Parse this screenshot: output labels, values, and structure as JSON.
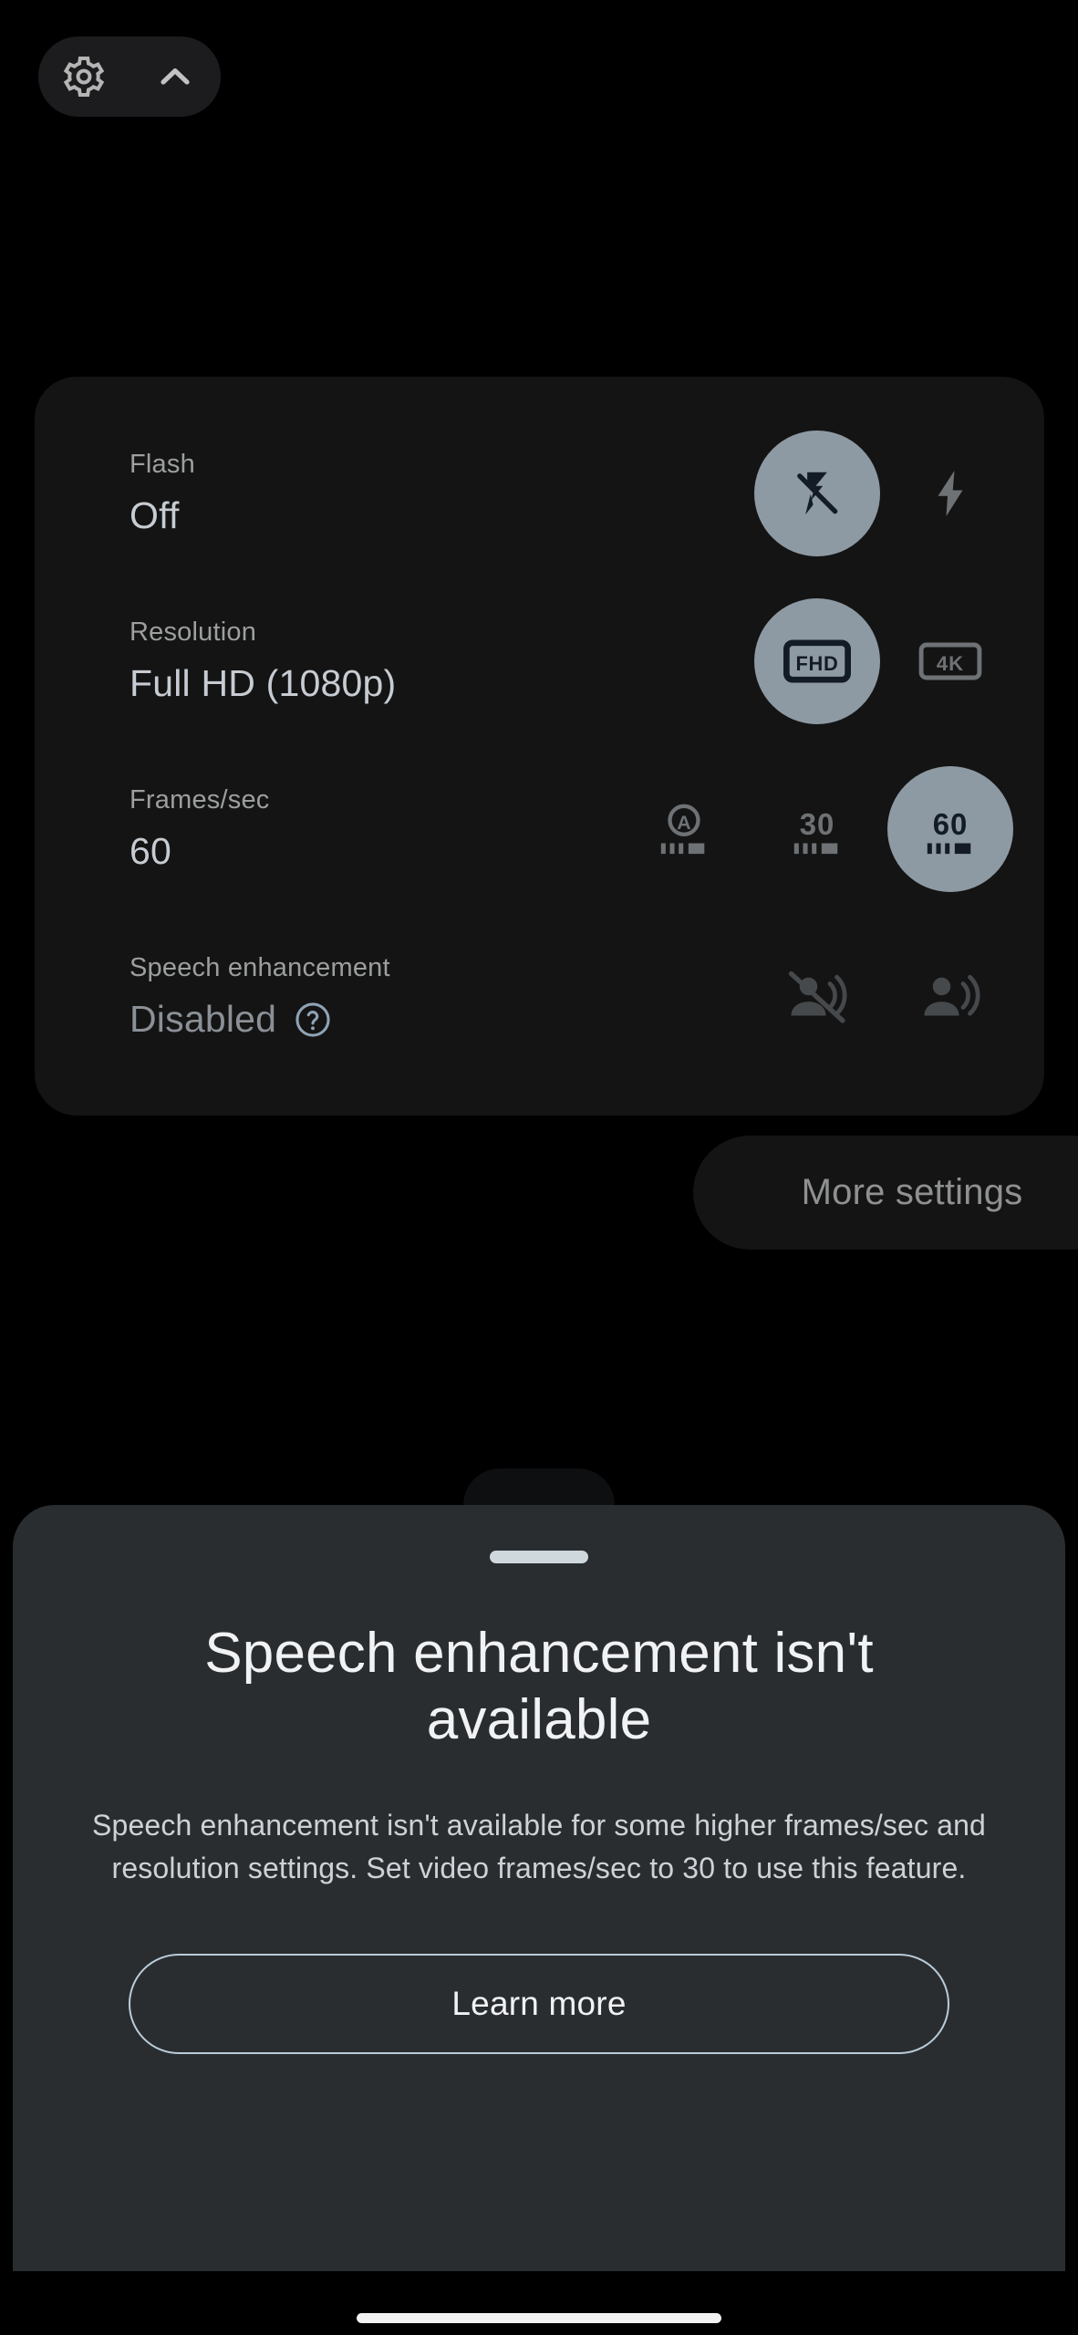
{
  "top_bar": {
    "settings_icon": "gear-icon",
    "collapse_icon": "chevron-up-icon"
  },
  "settings_panel": {
    "rows": [
      {
        "id": "flash",
        "label": "Flash",
        "value": "Off",
        "enabled": true,
        "options": [
          {
            "id": "flash-off",
            "icon": "flash-off-icon",
            "selected": true
          },
          {
            "id": "flash-on",
            "icon": "flash-on-icon",
            "selected": false
          }
        ]
      },
      {
        "id": "resolution",
        "label": "Resolution",
        "value": "Full HD (1080p)",
        "enabled": true,
        "options": [
          {
            "id": "resolution-fhd",
            "icon": "fhd-icon",
            "text": "FHD",
            "selected": true
          },
          {
            "id": "resolution-4k",
            "icon": "4k-icon",
            "text": "4K",
            "selected": false
          }
        ]
      },
      {
        "id": "frames-per-second",
        "label": "Frames/sec",
        "value": "60",
        "enabled": true,
        "options": [
          {
            "id": "fps-auto",
            "icon": "fps-auto-icon",
            "text": "A",
            "selected": false
          },
          {
            "id": "fps-30",
            "icon": "fps-30-icon",
            "text": "30",
            "selected": false
          },
          {
            "id": "fps-60",
            "icon": "fps-60-icon",
            "text": "60",
            "selected": true
          }
        ]
      },
      {
        "id": "speech-enhancement",
        "label": "Speech enhancement",
        "value": "Disabled",
        "enabled": false,
        "help_icon": "help-circle-icon",
        "options": [
          {
            "id": "speech-off",
            "icon": "voice-off-icon",
            "selected": false
          },
          {
            "id": "speech-on",
            "icon": "voice-on-icon",
            "selected": false
          }
        ]
      }
    ],
    "more_settings_label": "More settings"
  },
  "bottom_sheet": {
    "grabber": "drag-handle",
    "title": "Speech enhancement isn't available",
    "body": "Speech enhancement isn't available for some higher frames/sec and resolution settings. Set video frames/sec to 30 to use this feature.",
    "learn_more_label": "Learn more"
  },
  "colors": {
    "background": "#000000",
    "card": "#141414",
    "sheet": "#2a2d30",
    "selected_chip": "#8e9aa3",
    "value_text": "#c6ccd2",
    "label_text": "#9c9f9e",
    "accent_outline": "#b9ccd9"
  }
}
